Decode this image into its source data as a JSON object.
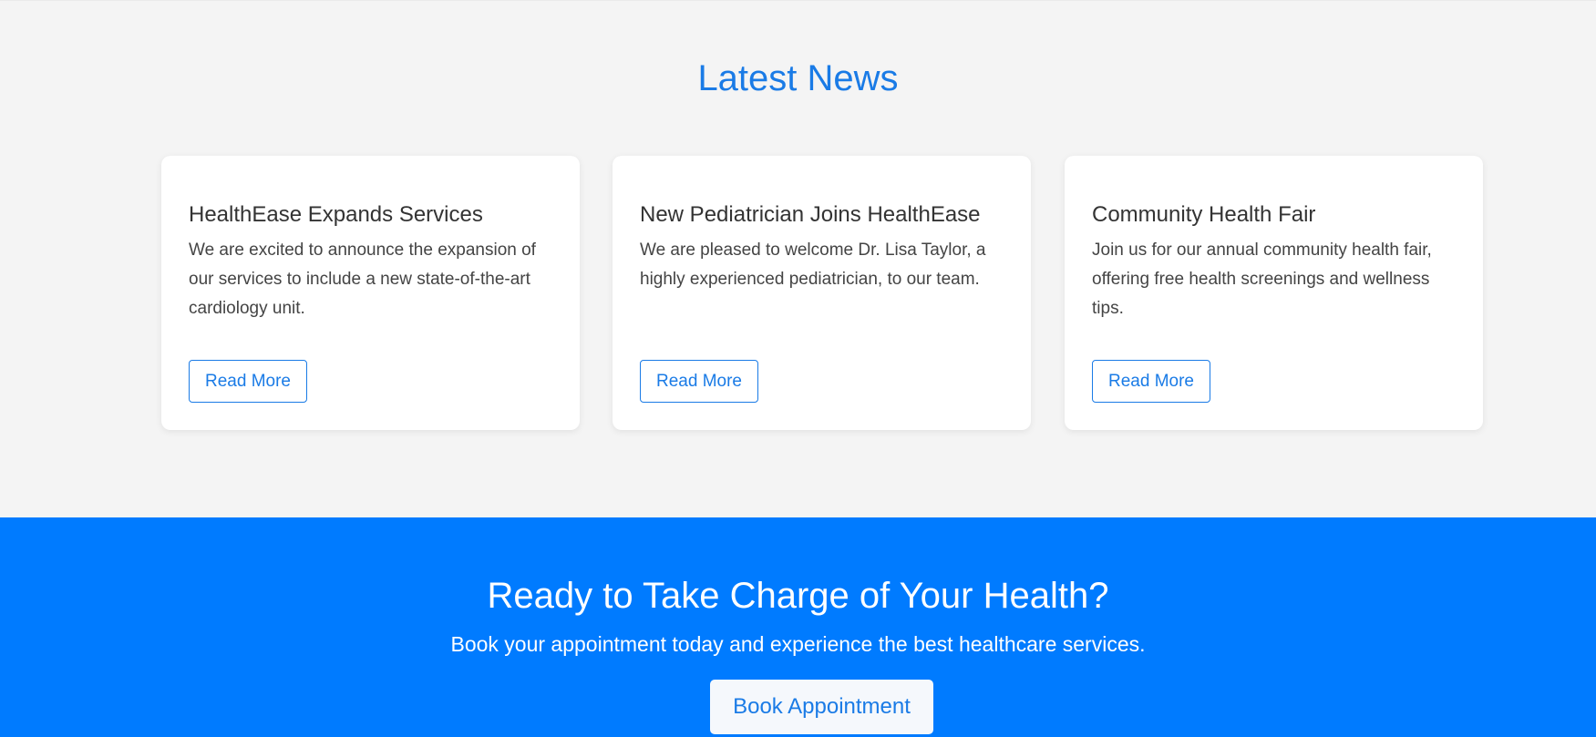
{
  "news": {
    "title": "Latest News",
    "cards": [
      {
        "title": "HealthEase Expands Services",
        "text": "We are excited to announce the expansion of our services to include a new state-of-the-art cardiology unit.",
        "button": "Read More"
      },
      {
        "title": "New Pediatrician Joins HealthEase",
        "text": "We are pleased to welcome Dr. Lisa Taylor, a highly experienced pediatrician, to our team.",
        "button": "Read More"
      },
      {
        "title": "Community Health Fair",
        "text": "Join us for our annual community health fair, offering free health screenings and wellness tips.",
        "button": "Read More"
      }
    ]
  },
  "cta": {
    "title": "Ready to Take Charge of Your Health?",
    "text": "Book your appointment today and experience the best healthcare services.",
    "button": "Book Appointment"
  },
  "colors": {
    "accent": "#007bff",
    "link_blue": "#1a7be6",
    "section_background": "#f4f4f4",
    "card_background": "#ffffff",
    "heading_text": "#333333"
  }
}
